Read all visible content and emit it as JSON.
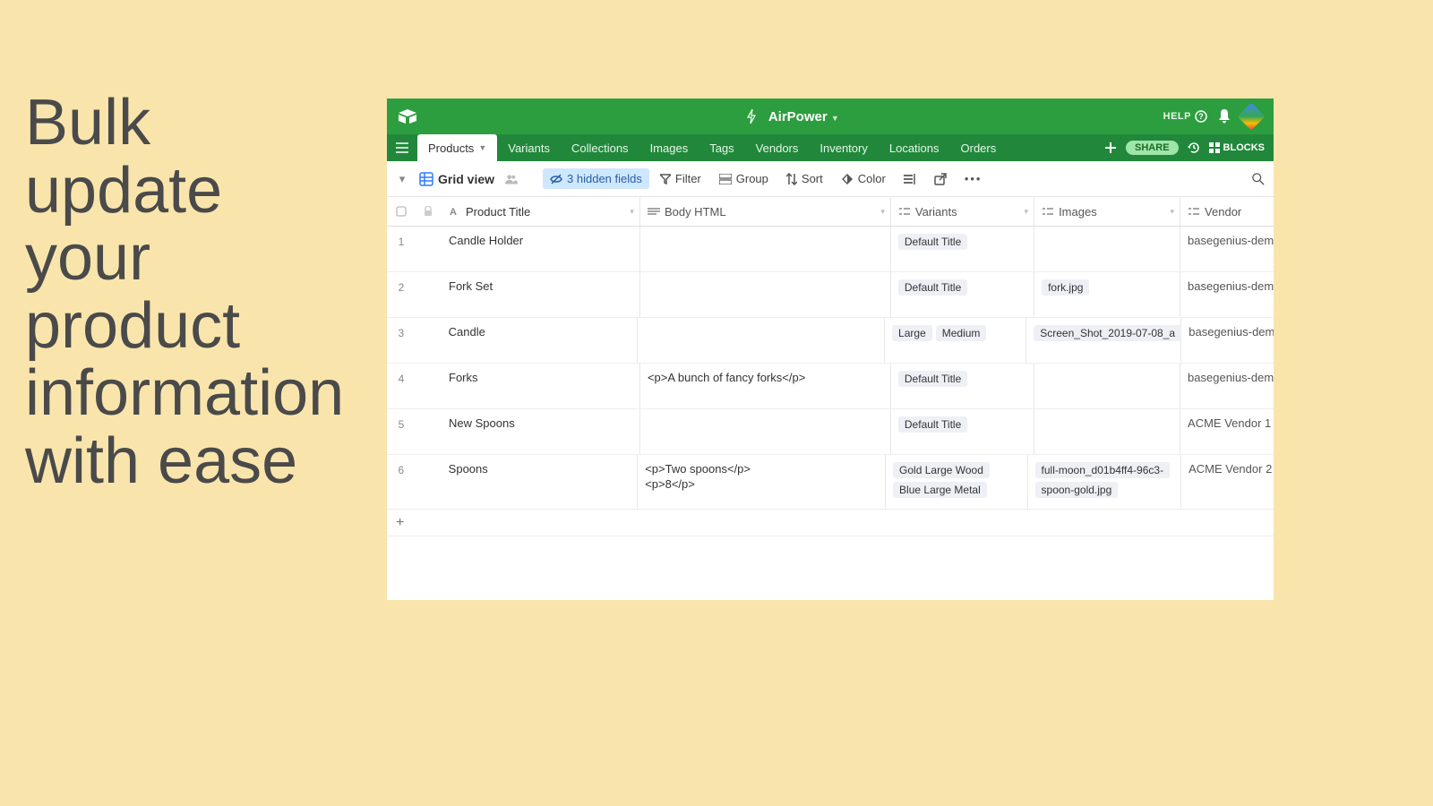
{
  "headline": "Bulk update your product information with ease",
  "header": {
    "base_name": "AirPower",
    "help": "HELP"
  },
  "tabs": [
    {
      "label": "Products",
      "active": true
    },
    {
      "label": "Variants"
    },
    {
      "label": "Collections"
    },
    {
      "label": "Images"
    },
    {
      "label": "Tags"
    },
    {
      "label": "Vendors"
    },
    {
      "label": "Inventory"
    },
    {
      "label": "Locations"
    },
    {
      "label": "Orders"
    }
  ],
  "tabs_right": {
    "share": "SHARE",
    "blocks": "BLOCKS"
  },
  "viewbar": {
    "view_name": "Grid view",
    "hidden_fields": "3 hidden fields",
    "filter": "Filter",
    "group": "Group",
    "sort": "Sort",
    "color": "Color"
  },
  "columns": {
    "title": "Product Title",
    "body": "Body HTML",
    "variants": "Variants",
    "images": "Images",
    "vendor": "Vendor"
  },
  "rows": [
    {
      "n": "1",
      "title": "Candle Holder",
      "body": "",
      "variants": [
        "Default Title"
      ],
      "images": [],
      "vendor": "basegenius-dem"
    },
    {
      "n": "2",
      "title": "Fork Set",
      "body": "",
      "variants": [
        "Default Title"
      ],
      "images": [
        "fork.jpg"
      ],
      "vendor": "basegenius-dem"
    },
    {
      "n": "3",
      "title": "Candle",
      "body": "",
      "variants": [
        "Large",
        "Medium"
      ],
      "images": [
        "Screen_Shot_2019-07-08_a"
      ],
      "vendor": "basegenius-dem"
    },
    {
      "n": "4",
      "title": "Forks",
      "body": "<p>A bunch of fancy forks</p>",
      "variants": [
        "Default Title"
      ],
      "images": [],
      "vendor": "basegenius-dem"
    },
    {
      "n": "5",
      "title": "New Spoons",
      "body": "",
      "variants": [
        "Default Title"
      ],
      "images": [],
      "vendor": "ACME Vendor 1"
    },
    {
      "n": "6",
      "title": "Spoons",
      "body": "<p>Two spoons</p>\n<p>8</p>",
      "variants": [
        "Gold Large Wood",
        "Blue Large Metal"
      ],
      "images": [
        "full-moon_d01b4ff4-96c3-",
        "spoon-gold.jpg"
      ],
      "vendor": "ACME Vendor 2"
    }
  ]
}
